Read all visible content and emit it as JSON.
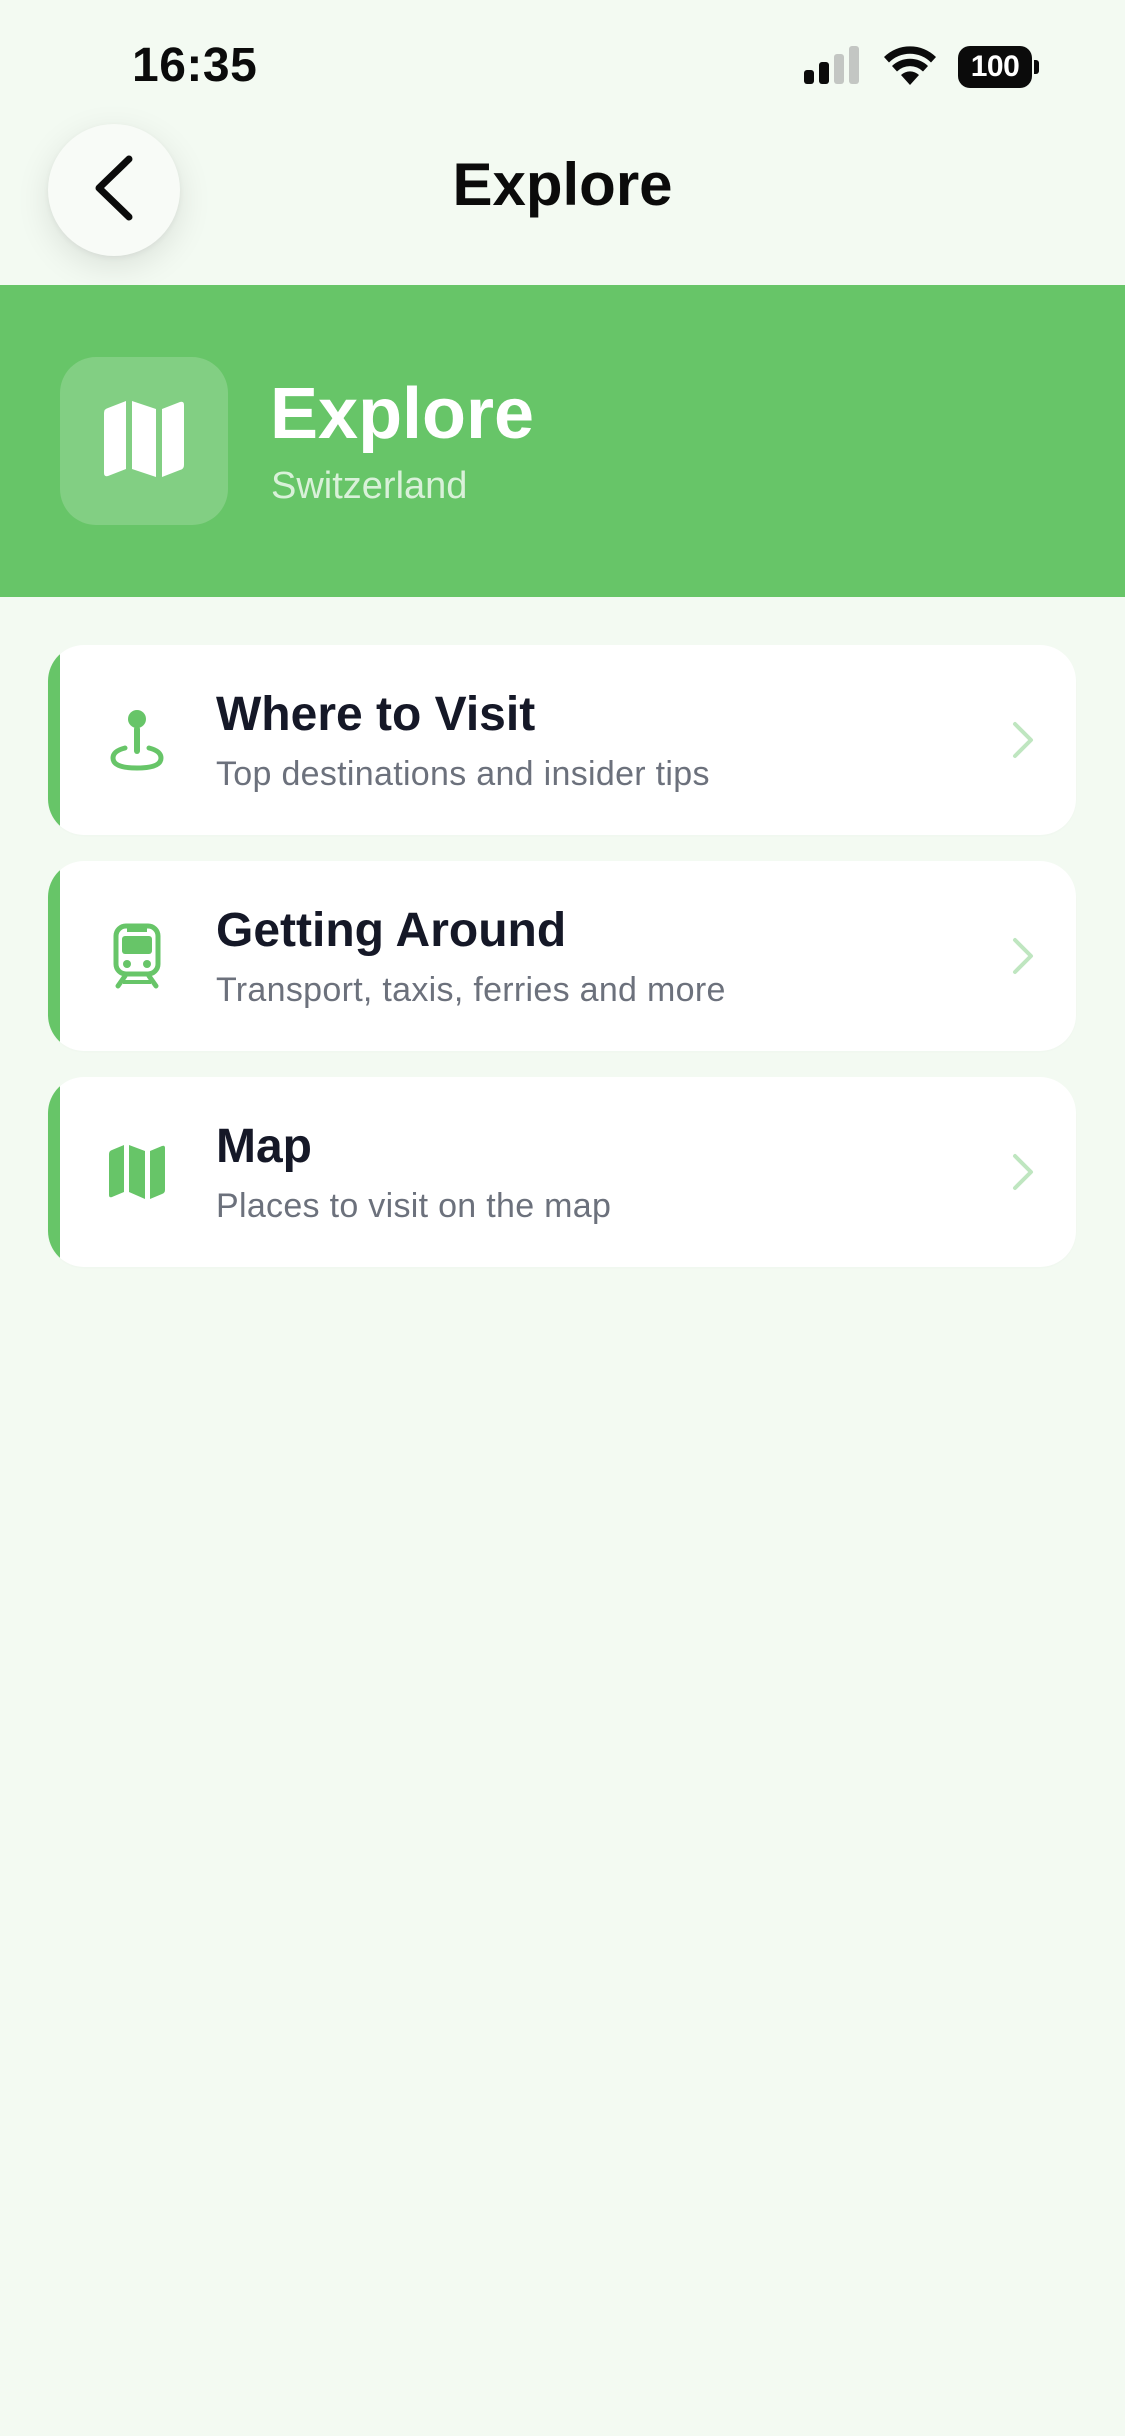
{
  "status_bar": {
    "time": "16:35",
    "battery_level": "100",
    "icons": [
      "signal-icon",
      "wifi-icon",
      "battery-icon"
    ]
  },
  "header": {
    "title": "Explore",
    "back_icon": "chevron-left-icon"
  },
  "hero": {
    "title": "Explore",
    "subtitle": "Switzerland",
    "icon": "map-icon"
  },
  "menu": {
    "items": [
      {
        "title": "Where to Visit",
        "description": "Top destinations and insider tips",
        "icon": "location-pin-icon"
      },
      {
        "title": "Getting Around",
        "description": "Transport, taxis, ferries and more",
        "icon": "train-icon"
      },
      {
        "title": "Map",
        "description": "Places to visit on the map",
        "icon": "map-icon"
      }
    ]
  },
  "colors": {
    "accent": "#67c568",
    "background": "#f3faf2",
    "card": "#ffffff",
    "title_text": "#151827",
    "secondary_text": "#6c717c",
    "chevron": "#bfe6c0"
  }
}
